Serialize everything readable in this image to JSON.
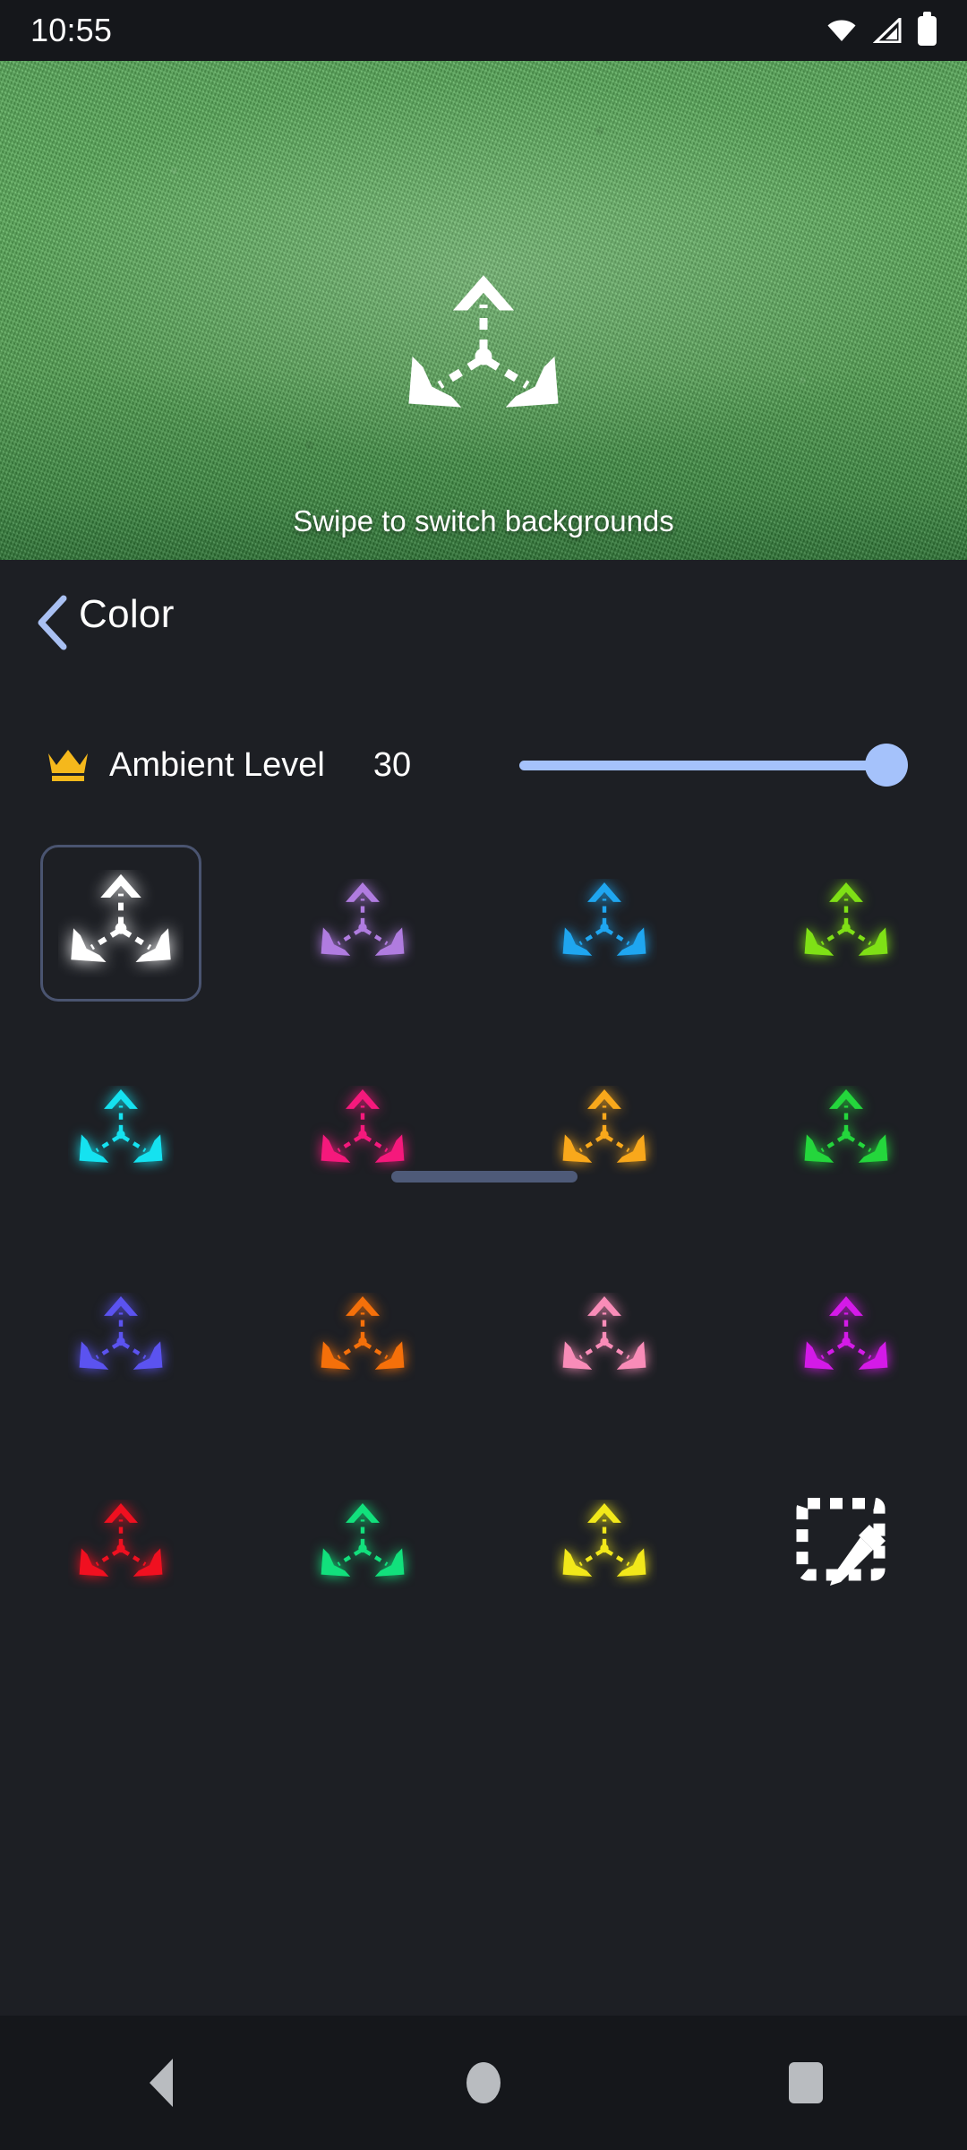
{
  "status_bar": {
    "time": "10:55",
    "icons": [
      "wifi-icon",
      "cellular-signal-icon",
      "battery-icon"
    ]
  },
  "preview": {
    "glyph": "three-way-arrow-icon",
    "glyph_color": "#FFFFFF",
    "hint_text": "Swipe to switch backgrounds",
    "background": "grass-wallpaper"
  },
  "sheet": {
    "back_icon": "chevron-left-icon",
    "back_icon_color": "#A9C0F2",
    "title": "Color",
    "drag_handle_color": "#4E5A78"
  },
  "ambient": {
    "premium_icon": "crown-icon",
    "premium_icon_color": "#F5B81C",
    "label": "Ambient Level",
    "value": "30",
    "slider": {
      "percent": 100,
      "min": "0",
      "max": "30",
      "accent_color": "#A5C2FB"
    }
  },
  "color_grid": {
    "rows": [
      [
        {
          "name": "white",
          "color": "#FFFFFF",
          "selected": true,
          "type": "swatch"
        },
        {
          "name": "lavender",
          "color": "#B07CE0",
          "selected": false,
          "type": "swatch"
        },
        {
          "name": "azure-blue",
          "color": "#1FA6F0",
          "selected": false,
          "type": "swatch"
        },
        {
          "name": "lime-green",
          "color": "#7FE016",
          "selected": false,
          "type": "swatch"
        }
      ],
      [
        {
          "name": "cyan",
          "color": "#15E2F0",
          "selected": false,
          "type": "swatch"
        },
        {
          "name": "hot-pink",
          "color": "#F5197C",
          "selected": false,
          "type": "swatch"
        },
        {
          "name": "amber",
          "color": "#F9A81B",
          "selected": false,
          "type": "swatch"
        },
        {
          "name": "green",
          "color": "#24D63C",
          "selected": false,
          "type": "swatch"
        }
      ],
      [
        {
          "name": "indigo",
          "color": "#5B53F0",
          "selected": false,
          "type": "swatch"
        },
        {
          "name": "orange",
          "color": "#F5700A",
          "selected": false,
          "type": "swatch"
        },
        {
          "name": "light-pink",
          "color": "#F98CB8",
          "selected": false,
          "type": "swatch"
        },
        {
          "name": "magenta",
          "color": "#D41AE8",
          "selected": false,
          "type": "swatch"
        }
      ],
      [
        {
          "name": "red",
          "color": "#F01020",
          "selected": false,
          "type": "swatch"
        },
        {
          "name": "spring-green",
          "color": "#12E07C",
          "selected": false,
          "type": "swatch"
        },
        {
          "name": "yellow",
          "color": "#F2E81A",
          "selected": false,
          "type": "swatch"
        },
        {
          "name": "custom-color",
          "color": "#FFFFFF",
          "selected": false,
          "type": "picker"
        }
      ]
    ]
  },
  "nav_bar": {
    "back_label": "Back",
    "home_label": "Home",
    "recents_label": "Recents",
    "icon_color": "#B9BCC0"
  },
  "theme": {
    "sheet_background": "#1D1F24",
    "status_background": "#15171B",
    "text_primary": "#FFFFFF"
  }
}
